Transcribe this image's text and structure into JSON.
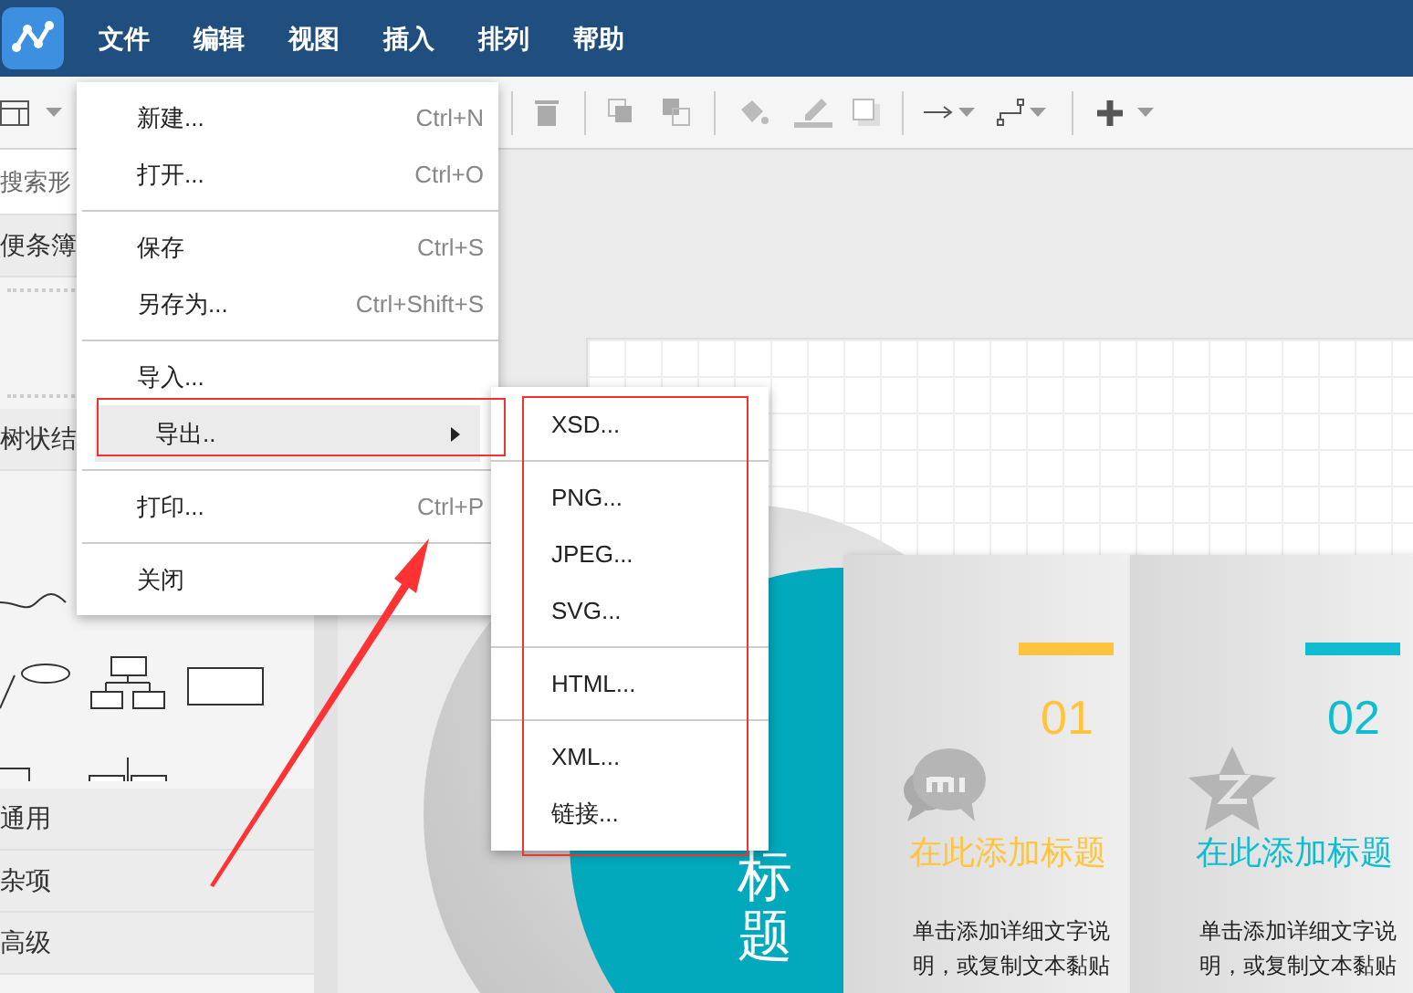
{
  "menubar": [
    "文件",
    "编辑",
    "视图",
    "插入",
    "排列",
    "帮助"
  ],
  "sidebar": {
    "search": {
      "placeholder": "搜索形"
    },
    "sections": [
      {
        "label": "便条簿",
        "kind": "scratch"
      },
      {
        "label": "树状结",
        "kind": "shapes"
      },
      {
        "label": "通用",
        "kind": "plain"
      },
      {
        "label": "杂项",
        "kind": "plain"
      },
      {
        "label": "高级",
        "kind": "plain"
      }
    ]
  },
  "file_menu": [
    {
      "kind": "item",
      "label": "新建...",
      "shortcut": "Ctrl+N",
      "highlighted": false,
      "submenu": false
    },
    {
      "kind": "item",
      "label": "打开...",
      "shortcut": "Ctrl+O",
      "highlighted": false,
      "submenu": false
    },
    {
      "kind": "separator"
    },
    {
      "kind": "item",
      "label": "保存",
      "shortcut": "Ctrl+S",
      "highlighted": false,
      "submenu": false
    },
    {
      "kind": "item",
      "label": "另存为...",
      "shortcut": "Ctrl+Shift+S",
      "highlighted": false,
      "submenu": false
    },
    {
      "kind": "separator"
    },
    {
      "kind": "item",
      "label": "导入...",
      "highlighted": false,
      "submenu": false
    },
    {
      "kind": "item",
      "label": "导出..",
      "highlighted": true,
      "submenu": true
    },
    {
      "kind": "separator"
    },
    {
      "kind": "item",
      "label": "打印...",
      "shortcut": "Ctrl+P",
      "highlighted": false,
      "submenu": false
    },
    {
      "kind": "separator"
    },
    {
      "kind": "item",
      "label": "关闭",
      "highlighted": false,
      "submenu": false
    }
  ],
  "export_menu": [
    {
      "kind": "item",
      "label": "XSD..."
    },
    {
      "kind": "separator"
    },
    {
      "kind": "item",
      "label": "PNG..."
    },
    {
      "kind": "item",
      "label": "JPEG..."
    },
    {
      "kind": "item",
      "label": "SVG..."
    },
    {
      "kind": "separator"
    },
    {
      "kind": "item",
      "label": "HTML..."
    },
    {
      "kind": "separator"
    },
    {
      "kind": "item",
      "label": "XML..."
    },
    {
      "kind": "item",
      "label": "链接..."
    }
  ],
  "canvas": {
    "side_title": "标题",
    "cards": [
      {
        "number": "01",
        "title": "在此添加标题",
        "text": "单击添加详细文字说明，或复制文本黏贴",
        "color": "#ffc43d"
      },
      {
        "number": "02",
        "title": "在此添加标题",
        "text": "单击添加详细文字说明，或复制文本黏贴",
        "color": "#0fbcd0"
      }
    ]
  }
}
